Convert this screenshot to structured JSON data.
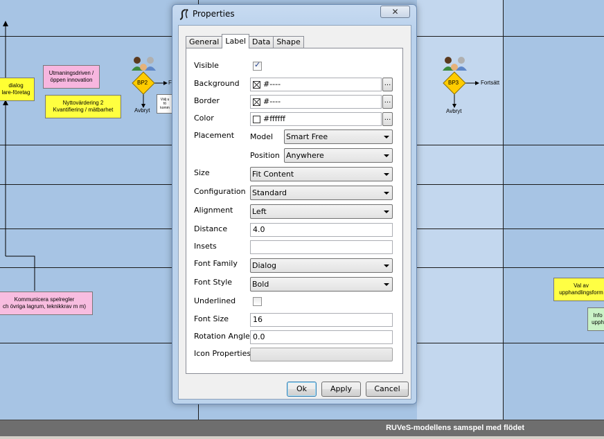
{
  "dialog": {
    "title": "Properties",
    "close_glyph": "✕",
    "tabs": [
      {
        "label": "General",
        "active": false
      },
      {
        "label": "Label",
        "active": true
      },
      {
        "label": "Data",
        "active": false
      },
      {
        "label": "Shape",
        "active": false
      }
    ],
    "fields": {
      "visible": {
        "label": "Visible",
        "checked": true
      },
      "background": {
        "label": "Background",
        "value": "#----"
      },
      "border": {
        "label": "Border",
        "value": "#----"
      },
      "color": {
        "label": "Color",
        "value": "#ffffff"
      },
      "placement": {
        "label": "Placement",
        "model_label": "Model",
        "model_value": "Smart Free",
        "position_label": "Position",
        "position_value": "Anywhere"
      },
      "size": {
        "label": "Size",
        "value": "Fit Content"
      },
      "configuration": {
        "label": "Configuration",
        "value": "Standard"
      },
      "alignment": {
        "label": "Alignment",
        "value": "Left"
      },
      "distance": {
        "label": "Distance",
        "value": "4.0"
      },
      "insets": {
        "label": "Insets",
        "value": ""
      },
      "font_family": {
        "label": "Font Family",
        "value": "Dialog"
      },
      "font_style": {
        "label": "Font Style",
        "value": "Bold"
      },
      "underlined": {
        "label": "Underlined",
        "checked": false
      },
      "font_size": {
        "label": "Font Size",
        "value": "16"
      },
      "rotation_angle": {
        "label": "Rotation Angle",
        "value": "0.0"
      },
      "icon_properties": {
        "label": "Icon Properties"
      }
    },
    "ellipsis_label": "...",
    "buttons": {
      "ok": "Ok",
      "apply": "Apply",
      "cancel": "Cancel"
    }
  },
  "diagram": {
    "notes": {
      "dialog_note": "dialog\nlare-företag",
      "utmaningsdriven": "Utmaningsdriven /\nöppen innovation",
      "nyttovardering": "Nyttovärdering 2\nKvantifiering / mätbarhet",
      "valj_note": "Välj u\nfö\nkomm",
      "kommunicera": "Kommunicera spelregler\nch övriga lagrum, teknikkrav m m)",
      "val_av": "Val av\nupphandlingsform",
      "info": "Info\nupph"
    },
    "bp2": {
      "label": "BP2",
      "right": "F",
      "down": "Avbryt"
    },
    "bp3": {
      "label": "BP3",
      "right": "Fortsätt",
      "down": "Avbryt"
    },
    "colors": {
      "lane": "#a7c4e4",
      "lane_light": "#c3d7ee",
      "diamond": "#ffcc00"
    }
  },
  "status_bar": {
    "text": "RUVeS-modellens samspel med flödet"
  }
}
